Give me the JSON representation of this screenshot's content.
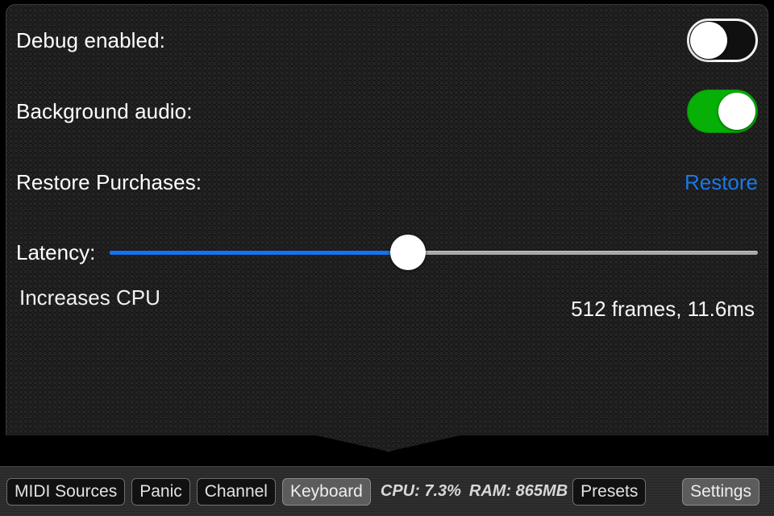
{
  "panel": {
    "rows": [
      {
        "label": "Debug enabled:",
        "control": "toggle",
        "state": "off"
      },
      {
        "label": "Background audio:",
        "control": "toggle",
        "state": "on"
      },
      {
        "label": "Restore Purchases:",
        "control": "link",
        "action_label": "Restore"
      }
    ],
    "latency": {
      "label": "Latency:",
      "hint": "Increases CPU",
      "readout": "512 frames, 11.6ms",
      "frames": 512,
      "milliseconds": 11.6,
      "percent": 46
    }
  },
  "toolbar": {
    "buttons": [
      {
        "label": "MIDI Sources",
        "active": false
      },
      {
        "label": "Panic",
        "active": false
      },
      {
        "label": "Channel",
        "active": false
      },
      {
        "label": "Keyboard",
        "active": true
      }
    ],
    "stats": {
      "cpu": "CPU: 7.3%",
      "ram": "RAM: 865MB"
    },
    "presets_label": "Presets",
    "settings_label": "Settings"
  },
  "colors": {
    "toggle_on": "#07b007",
    "link_blue": "#1a78e8",
    "slider_fill": "#1274f0",
    "slider_track": "#a8a8a8",
    "panel_bg": "#1d1d1d",
    "toolbar_bg": "#2b2b2b"
  }
}
